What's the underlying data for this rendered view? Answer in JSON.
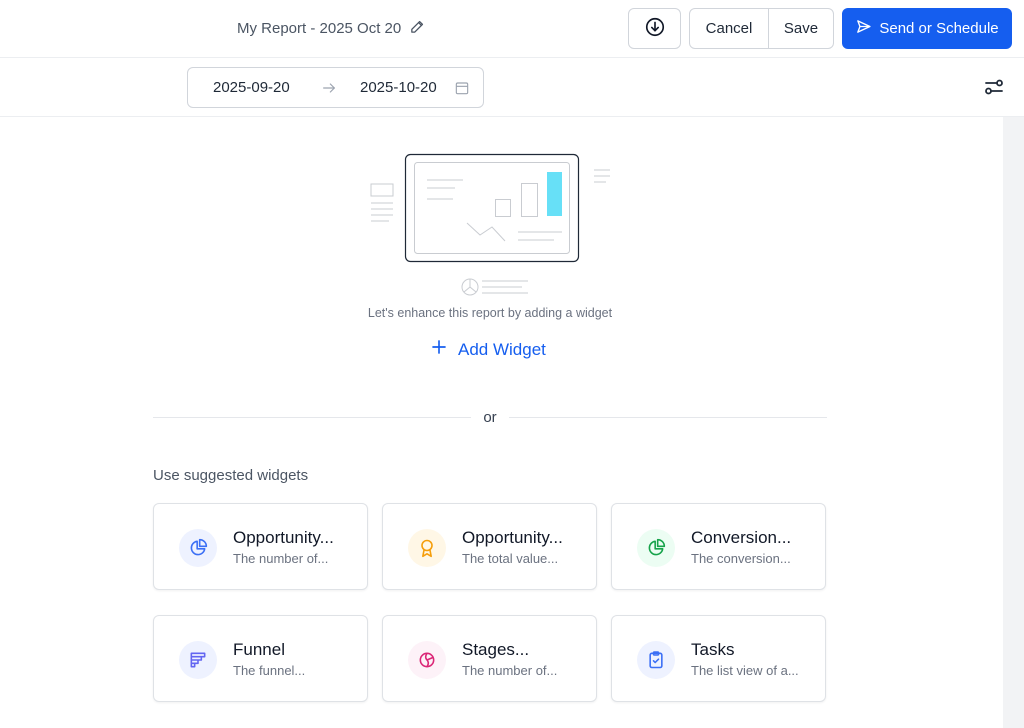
{
  "header": {
    "report_title": "My Report - 2025 Oct 20",
    "cancel_label": "Cancel",
    "save_label": "Save",
    "send_label": "Send or Schedule"
  },
  "date_range": {
    "start": "2025-09-20",
    "end": "2025-10-20"
  },
  "empty_state": {
    "message": "Let's enhance this report by adding a widget",
    "add_label": "Add Widget"
  },
  "divider_text": "or",
  "suggested": {
    "label": "Use suggested widgets",
    "cards": [
      {
        "title": "Opportunity...",
        "desc": "The number of...",
        "icon": "pie-chart-icon",
        "color": "#3b6ff5",
        "bg": "#eef2ff"
      },
      {
        "title": "Opportunity...",
        "desc": "The total value...",
        "icon": "award-icon",
        "color": "#f59e0b",
        "bg": "#fff7e6"
      },
      {
        "title": "Conversion...",
        "desc": "The conversion...",
        "icon": "pie-chart-icon",
        "color": "#16a34a",
        "bg": "#ecfdf3"
      },
      {
        "title": "Funnel",
        "desc": "The funnel...",
        "icon": "funnel-icon",
        "color": "#6366f1",
        "bg": "#eef2ff"
      },
      {
        "title": "Stages...",
        "desc": "The number of...",
        "icon": "pie-slice-icon",
        "color": "#db2777",
        "bg": "#fdf2f8"
      },
      {
        "title": "Tasks",
        "desc": "The list view of a...",
        "icon": "clipboard-check-icon",
        "color": "#3b6ff5",
        "bg": "#eef2ff"
      }
    ]
  },
  "colors": {
    "primary": "#155eef",
    "accent_bar": "#67e0f7"
  }
}
